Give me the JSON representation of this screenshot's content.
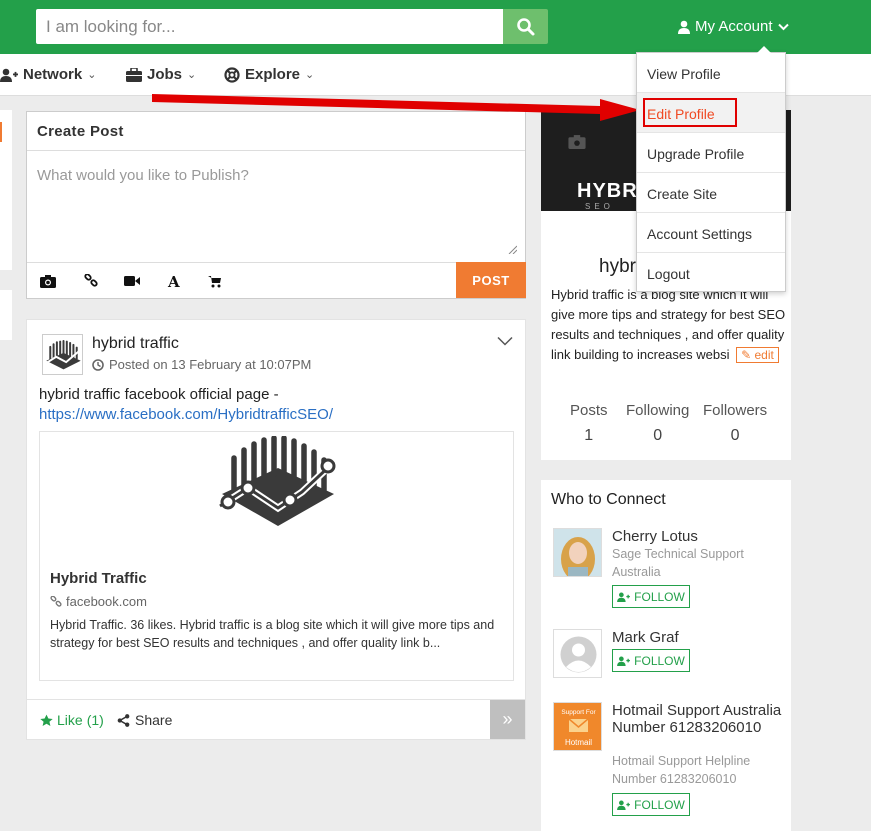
{
  "header": {
    "search_placeholder": "I am looking for...",
    "account_label": "My Account"
  },
  "nav": {
    "network": "Network",
    "jobs": "Jobs",
    "explore": "Explore"
  },
  "account_menu": {
    "items": [
      "View Profile",
      "Edit Profile",
      "Upgrade Profile",
      "Create Site",
      "Account Settings",
      "Logout"
    ],
    "highlighted": "Edit Profile"
  },
  "create_post": {
    "title": "Create Post",
    "placeholder": "What would you like to Publish?",
    "post_button": "POST"
  },
  "feed_post": {
    "author": "hybrid traffic",
    "date": "Posted on 13 February at 10:07PM",
    "text": "hybrid traffic facebook official page -",
    "link": "https://www.facebook.com/HybridtrafficSEO/",
    "card": {
      "title": "Hybrid Traffic",
      "source": "facebook.com",
      "description": "Hybrid Traffic. 36 likes. Hybrid traffic is a blog site which it will give more tips and strategy for best SEO results and techniques , and offer quality link b..."
    },
    "like_label": "Like",
    "like_count": "(1)",
    "share_label": "Share"
  },
  "profile": {
    "cover_logo": "HYBRI",
    "cover_sub": "SEO",
    "name": "hybr",
    "bio": "Hybrid traffic is a blog site which it will give more tips and strategy for best SEO results and techniques , and offer quality link building to increases websi",
    "edit_label": "edit",
    "stats": [
      {
        "label": "Posts",
        "value": "1"
      },
      {
        "label": "Following",
        "value": "0"
      },
      {
        "label": "Followers",
        "value": "0"
      }
    ]
  },
  "connect": {
    "title": "Who to Connect",
    "follow_label": "FOLLOW",
    "people": [
      {
        "name": "Cherry Lotus",
        "subtitle": "Sage Technical Support Australia"
      },
      {
        "name": "Mark Graf",
        "subtitle": ""
      },
      {
        "name": "Hotmail Support Australia Number 61283206010",
        "subtitle": "Hotmail Support Helpline Number 61283206010",
        "avatar_text_top": "Support For",
        "avatar_text_bottom": "Hotmail"
      }
    ]
  },
  "colors": {
    "brand_green": "#23a04a",
    "accent_orange": "#f07b32",
    "annotation_red": "#e00000"
  }
}
